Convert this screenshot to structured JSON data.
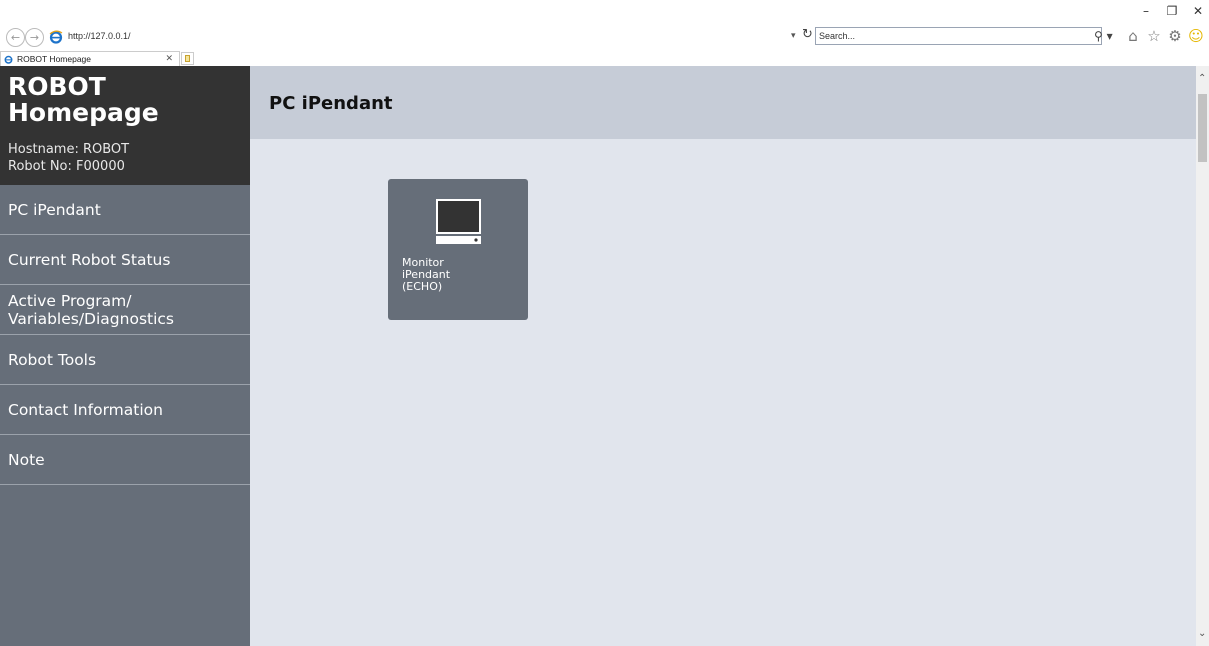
{
  "browser": {
    "address": "http://127.0.0.1/",
    "search_placeholder": "Search...",
    "tab_title": "ROBOT Homepage",
    "back_icon": "back-arrow-icon",
    "forward_icon": "forward-arrow-icon"
  },
  "sidebar": {
    "brand_title": "ROBOT Homepage",
    "hostname": "Hostname: ROBOT",
    "robot_no": "Robot No: F00000",
    "items": [
      {
        "label": "PC iPendant"
      },
      {
        "label": "Current Robot Status"
      },
      {
        "label": "Active Program/\nVariables/Diagnostics"
      },
      {
        "label": "Robot Tools"
      },
      {
        "label": "Contact Information"
      },
      {
        "label": "Note"
      }
    ]
  },
  "main": {
    "title": "PC iPendant",
    "tiles": [
      {
        "label": "Monitor\niPendant\n(ECHO)",
        "icon": "monitor-icon"
      }
    ]
  },
  "colors": {
    "sidebar_bg": "#666e79",
    "brand_bg": "#333333",
    "header_bg": "#c6ccd7",
    "content_bg": "#e1e5ed"
  }
}
